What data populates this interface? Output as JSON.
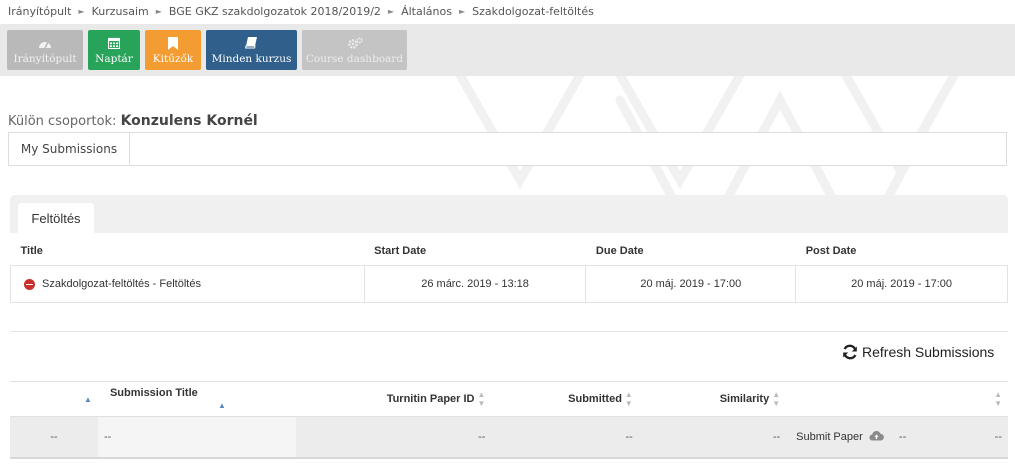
{
  "breadcrumb": [
    "Irányítópult",
    "Kurzusaim",
    "BGE GKZ szakdolgozatok 2018/2019/2",
    "Általános",
    "Szakdolgozat-feltöltés"
  ],
  "toolbar": {
    "buttons": [
      {
        "label": "Irányítópult",
        "icon": "dashboard-icon",
        "color": "#b9b9b9"
      },
      {
        "label": "Naptár",
        "icon": "calendar-icon",
        "color": "#27a35a"
      },
      {
        "label": "Kitűzők",
        "icon": "bookmark-icon",
        "color": "#f39c32"
      },
      {
        "label": "Minden kurzus",
        "icon": "book-icon",
        "color": "#2f5f8a"
      },
      {
        "label": "Course dashboard",
        "icon": "cogs-icon",
        "color": "#c4c4c4"
      }
    ]
  },
  "groups": {
    "label": "Külön csoportok:",
    "value": "Konzulens Kornél"
  },
  "subtabs": [
    "My Submissions"
  ],
  "panel": {
    "tab": "Feltöltés"
  },
  "assignment_table": {
    "headers": [
      "Title",
      "Start Date",
      "Due Date",
      "Post Date"
    ],
    "rows": [
      {
        "title": "Szakdolgozat-feltöltés - Feltöltés",
        "start": "26 márc. 2019 - 13:18",
        "due": "20 máj. 2019 - 17:00",
        "post": "20 máj. 2019 - 17:00"
      }
    ]
  },
  "refresh": {
    "label": "Refresh Submissions"
  },
  "submission_table": {
    "headers": [
      "Submission Title",
      "Turnitin Paper ID",
      "Submitted",
      "Similarity"
    ],
    "row": {
      "c0": "--",
      "title": "--",
      "paper_id": "--",
      "submitted": "--",
      "similarity": "--",
      "submit_label": "Submit Paper",
      "grade": "--",
      "last": "--"
    }
  }
}
